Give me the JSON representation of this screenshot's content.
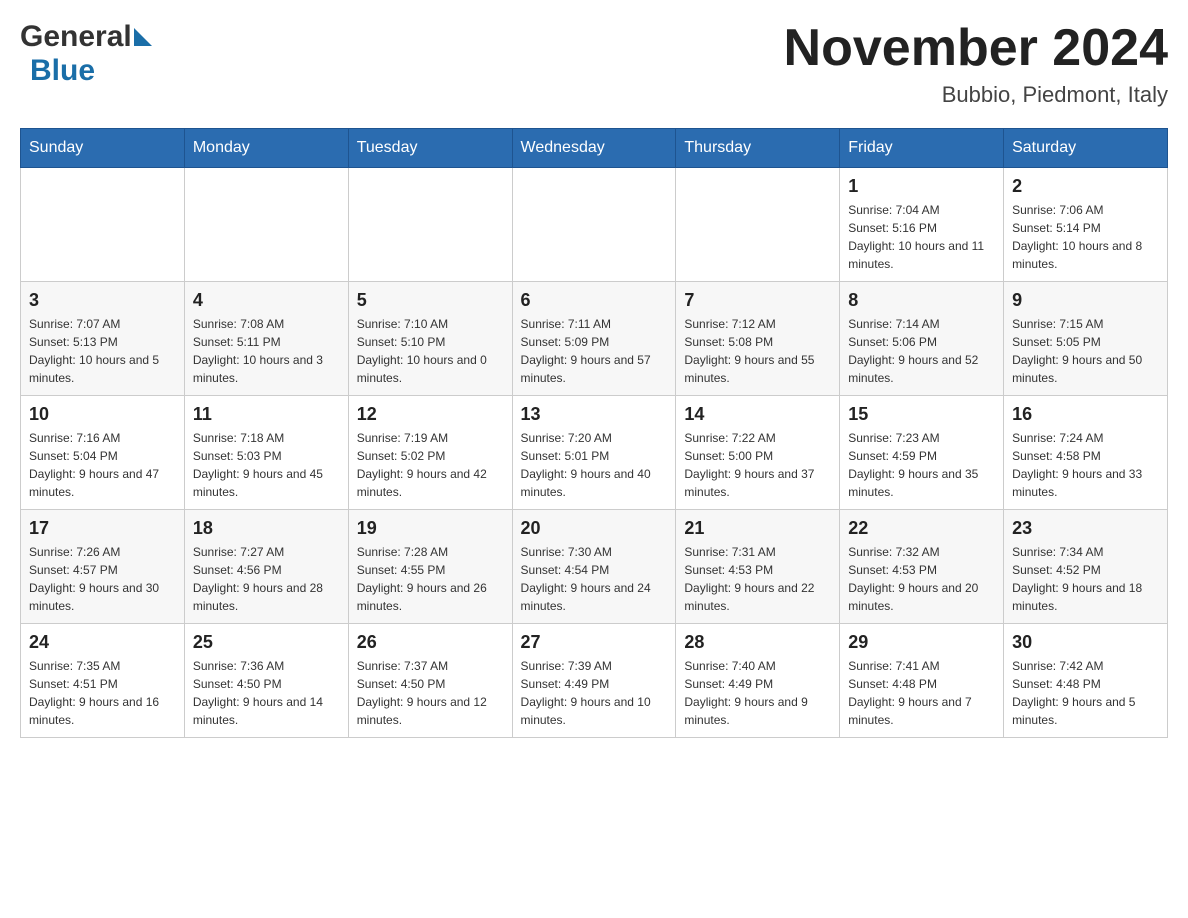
{
  "header": {
    "month_year": "November 2024",
    "location": "Bubbio, Piedmont, Italy",
    "logo_general": "General",
    "logo_blue": "Blue"
  },
  "days_of_week": [
    "Sunday",
    "Monday",
    "Tuesday",
    "Wednesday",
    "Thursday",
    "Friday",
    "Saturday"
  ],
  "weeks": [
    [
      {
        "day": "",
        "sunrise": "",
        "sunset": "",
        "daylight": ""
      },
      {
        "day": "",
        "sunrise": "",
        "sunset": "",
        "daylight": ""
      },
      {
        "day": "",
        "sunrise": "",
        "sunset": "",
        "daylight": ""
      },
      {
        "day": "",
        "sunrise": "",
        "sunset": "",
        "daylight": ""
      },
      {
        "day": "",
        "sunrise": "",
        "sunset": "",
        "daylight": ""
      },
      {
        "day": "1",
        "sunrise": "Sunrise: 7:04 AM",
        "sunset": "Sunset: 5:16 PM",
        "daylight": "Daylight: 10 hours and 11 minutes."
      },
      {
        "day": "2",
        "sunrise": "Sunrise: 7:06 AM",
        "sunset": "Sunset: 5:14 PM",
        "daylight": "Daylight: 10 hours and 8 minutes."
      }
    ],
    [
      {
        "day": "3",
        "sunrise": "Sunrise: 7:07 AM",
        "sunset": "Sunset: 5:13 PM",
        "daylight": "Daylight: 10 hours and 5 minutes."
      },
      {
        "day": "4",
        "sunrise": "Sunrise: 7:08 AM",
        "sunset": "Sunset: 5:11 PM",
        "daylight": "Daylight: 10 hours and 3 minutes."
      },
      {
        "day": "5",
        "sunrise": "Sunrise: 7:10 AM",
        "sunset": "Sunset: 5:10 PM",
        "daylight": "Daylight: 10 hours and 0 minutes."
      },
      {
        "day": "6",
        "sunrise": "Sunrise: 7:11 AM",
        "sunset": "Sunset: 5:09 PM",
        "daylight": "Daylight: 9 hours and 57 minutes."
      },
      {
        "day": "7",
        "sunrise": "Sunrise: 7:12 AM",
        "sunset": "Sunset: 5:08 PM",
        "daylight": "Daylight: 9 hours and 55 minutes."
      },
      {
        "day": "8",
        "sunrise": "Sunrise: 7:14 AM",
        "sunset": "Sunset: 5:06 PM",
        "daylight": "Daylight: 9 hours and 52 minutes."
      },
      {
        "day": "9",
        "sunrise": "Sunrise: 7:15 AM",
        "sunset": "Sunset: 5:05 PM",
        "daylight": "Daylight: 9 hours and 50 minutes."
      }
    ],
    [
      {
        "day": "10",
        "sunrise": "Sunrise: 7:16 AM",
        "sunset": "Sunset: 5:04 PM",
        "daylight": "Daylight: 9 hours and 47 minutes."
      },
      {
        "day": "11",
        "sunrise": "Sunrise: 7:18 AM",
        "sunset": "Sunset: 5:03 PM",
        "daylight": "Daylight: 9 hours and 45 minutes."
      },
      {
        "day": "12",
        "sunrise": "Sunrise: 7:19 AM",
        "sunset": "Sunset: 5:02 PM",
        "daylight": "Daylight: 9 hours and 42 minutes."
      },
      {
        "day": "13",
        "sunrise": "Sunrise: 7:20 AM",
        "sunset": "Sunset: 5:01 PM",
        "daylight": "Daylight: 9 hours and 40 minutes."
      },
      {
        "day": "14",
        "sunrise": "Sunrise: 7:22 AM",
        "sunset": "Sunset: 5:00 PM",
        "daylight": "Daylight: 9 hours and 37 minutes."
      },
      {
        "day": "15",
        "sunrise": "Sunrise: 7:23 AM",
        "sunset": "Sunset: 4:59 PM",
        "daylight": "Daylight: 9 hours and 35 minutes."
      },
      {
        "day": "16",
        "sunrise": "Sunrise: 7:24 AM",
        "sunset": "Sunset: 4:58 PM",
        "daylight": "Daylight: 9 hours and 33 minutes."
      }
    ],
    [
      {
        "day": "17",
        "sunrise": "Sunrise: 7:26 AM",
        "sunset": "Sunset: 4:57 PM",
        "daylight": "Daylight: 9 hours and 30 minutes."
      },
      {
        "day": "18",
        "sunrise": "Sunrise: 7:27 AM",
        "sunset": "Sunset: 4:56 PM",
        "daylight": "Daylight: 9 hours and 28 minutes."
      },
      {
        "day": "19",
        "sunrise": "Sunrise: 7:28 AM",
        "sunset": "Sunset: 4:55 PM",
        "daylight": "Daylight: 9 hours and 26 minutes."
      },
      {
        "day": "20",
        "sunrise": "Sunrise: 7:30 AM",
        "sunset": "Sunset: 4:54 PM",
        "daylight": "Daylight: 9 hours and 24 minutes."
      },
      {
        "day": "21",
        "sunrise": "Sunrise: 7:31 AM",
        "sunset": "Sunset: 4:53 PM",
        "daylight": "Daylight: 9 hours and 22 minutes."
      },
      {
        "day": "22",
        "sunrise": "Sunrise: 7:32 AM",
        "sunset": "Sunset: 4:53 PM",
        "daylight": "Daylight: 9 hours and 20 minutes."
      },
      {
        "day": "23",
        "sunrise": "Sunrise: 7:34 AM",
        "sunset": "Sunset: 4:52 PM",
        "daylight": "Daylight: 9 hours and 18 minutes."
      }
    ],
    [
      {
        "day": "24",
        "sunrise": "Sunrise: 7:35 AM",
        "sunset": "Sunset: 4:51 PM",
        "daylight": "Daylight: 9 hours and 16 minutes."
      },
      {
        "day": "25",
        "sunrise": "Sunrise: 7:36 AM",
        "sunset": "Sunset: 4:50 PM",
        "daylight": "Daylight: 9 hours and 14 minutes."
      },
      {
        "day": "26",
        "sunrise": "Sunrise: 7:37 AM",
        "sunset": "Sunset: 4:50 PM",
        "daylight": "Daylight: 9 hours and 12 minutes."
      },
      {
        "day": "27",
        "sunrise": "Sunrise: 7:39 AM",
        "sunset": "Sunset: 4:49 PM",
        "daylight": "Daylight: 9 hours and 10 minutes."
      },
      {
        "day": "28",
        "sunrise": "Sunrise: 7:40 AM",
        "sunset": "Sunset: 4:49 PM",
        "daylight": "Daylight: 9 hours and 9 minutes."
      },
      {
        "day": "29",
        "sunrise": "Sunrise: 7:41 AM",
        "sunset": "Sunset: 4:48 PM",
        "daylight": "Daylight: 9 hours and 7 minutes."
      },
      {
        "day": "30",
        "sunrise": "Sunrise: 7:42 AM",
        "sunset": "Sunset: 4:48 PM",
        "daylight": "Daylight: 9 hours and 5 minutes."
      }
    ]
  ]
}
